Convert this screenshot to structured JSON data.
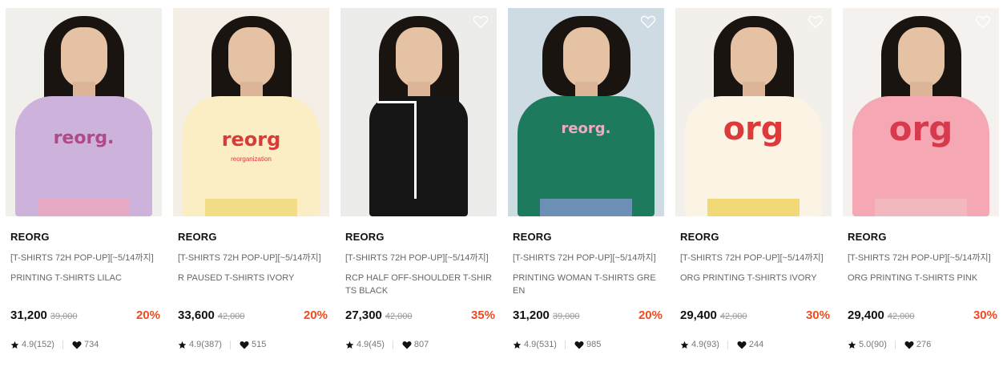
{
  "products": [
    {
      "brand": "REORG",
      "promo": "[T-SHIRTS 72H POP-UP][~5/14까지]",
      "name": "PRINTING T-SHIRTS LILAC",
      "price": "31,200",
      "original_price": "39,000",
      "discount": "20%",
      "rating": "4.9(152)",
      "likes": "734",
      "image": {
        "print_text": "reorg.",
        "print_sub": "",
        "shirt_color": "#cdb2dc",
        "print_color": "#b04a86",
        "bg": "#f1efec",
        "lower_color": "#e7a9c3"
      }
    },
    {
      "brand": "REORG",
      "promo": "[T-SHIRTS 72H POP-UP][~5/14까지]",
      "name": "R PAUSED T-SHIRTS IVORY",
      "price": "33,600",
      "original_price": "42,000",
      "discount": "20%",
      "rating": "4.9(387)",
      "likes": "515",
      "image": {
        "print_text": "reorg",
        "print_sub": "reorganization",
        "shirt_color": "#fbeec4",
        "print_color": "#d93a3a",
        "bg": "#f4eee6",
        "lower_color": "#f3dd86"
      }
    },
    {
      "brand": "REORG",
      "promo": "[T-SHIRTS 72H POP-UP][~5/14까지]",
      "name": "RCP HALF OFF-SHOULDER T-SHIRTS BLACK",
      "price": "27,300",
      "original_price": "42,000",
      "discount": "35%",
      "rating": "4.9(45)",
      "likes": "807",
      "image": {
        "print_text": "",
        "print_sub": "",
        "shirt_color": "#161616",
        "print_color": "#ffffff",
        "bg": "#ececea",
        "lower_color": "#161616"
      }
    },
    {
      "brand": "REORG",
      "promo": "[T-SHIRTS 72H POP-UP][~5/14까지]",
      "name": "PRINTING WOMAN T-SHIRTS GREEN",
      "price": "31,200",
      "original_price": "39,000",
      "discount": "20%",
      "rating": "4.9(531)",
      "likes": "985",
      "image": {
        "print_text": "reorg.",
        "print_sub": "",
        "shirt_color": "#1d7a5d",
        "print_color": "#f2a9c4",
        "bg": "#cfdbe3",
        "lower_color": "#6c8fb6"
      }
    },
    {
      "brand": "REORG",
      "promo": "[T-SHIRTS 72H POP-UP][~5/14까지]",
      "name": "ORG PRINTING T-SHIRTS IVORY",
      "price": "29,400",
      "original_price": "42,000",
      "discount": "30%",
      "rating": "4.9(93)",
      "likes": "244",
      "image": {
        "print_text": "org",
        "print_sub": "",
        "shirt_color": "#fbf3e3",
        "print_color": "#dc3b3b",
        "bg": "#f3f0eb",
        "lower_color": "#f1d977"
      }
    },
    {
      "brand": "REORG",
      "promo": "[T-SHIRTS 72H POP-UP][~5/14까지]",
      "name": "ORG PRINTING T-SHIRTS PINK",
      "price": "29,400",
      "original_price": "42,000",
      "discount": "30%",
      "rating": "5.0(90)",
      "likes": "276",
      "image": {
        "print_text": "org",
        "print_sub": "",
        "shirt_color": "#f6a7b4",
        "print_color": "#d63a4c",
        "bg": "#f4f1ee",
        "lower_color": "#f3b7c0"
      }
    }
  ],
  "icons": {
    "wishlist": "heart-outline-icon",
    "rating": "star-icon",
    "likes": "heart-filled-icon"
  },
  "colors": {
    "discount": "#f04a1e",
    "brand": "#111111",
    "muted": "#666666"
  }
}
